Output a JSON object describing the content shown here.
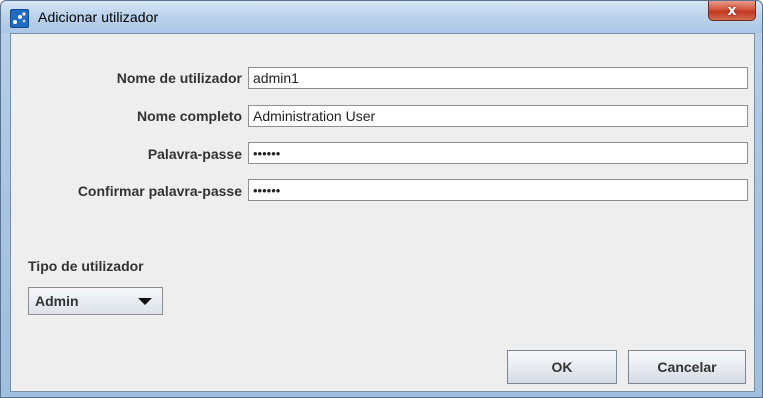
{
  "window": {
    "title": "Adicionar utilizador",
    "close_label": "x"
  },
  "form": {
    "fields": [
      {
        "label": "Nome de utilizador",
        "value": "admin1"
      },
      {
        "label": "Nome completo",
        "value": "Administration User"
      },
      {
        "label": "Palavra-passe",
        "value": "••••••"
      },
      {
        "label": "Confirmar palavra-passe",
        "value": "••••••"
      }
    ]
  },
  "user_type": {
    "label": "Tipo de utilizador",
    "selected": "Admin"
  },
  "buttons": {
    "ok_label": "OK",
    "cancel_label": "Cancelar"
  },
  "icons": {
    "app": "app-icon",
    "dropdown": "chevron-down-icon"
  },
  "colors": {
    "title_bar": "#bcd3ec",
    "close_button": "#c0391f",
    "dialog_background": "#eeeeee",
    "label_text": "#333333"
  }
}
